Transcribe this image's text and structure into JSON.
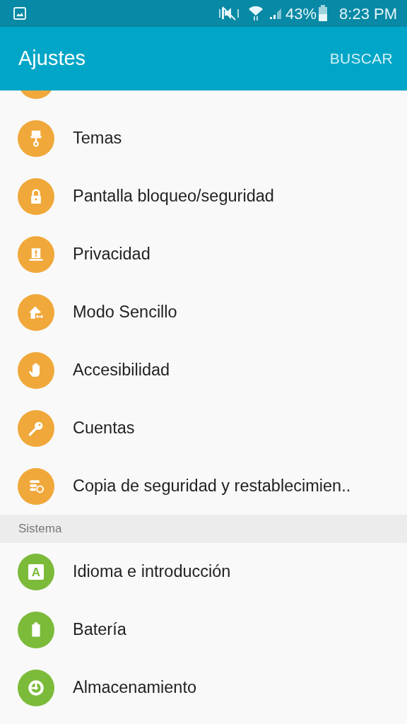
{
  "status_bar": {
    "battery_text": "43%",
    "time": "8:23 PM"
  },
  "app_bar": {
    "title": "Ajustes",
    "action": "BUSCAR"
  },
  "sections": [
    {
      "items": [
        {
          "kind": "partial",
          "color": "#f0a83a"
        },
        {
          "kind": "brush",
          "label": "Temas",
          "color": "#f0a83a"
        },
        {
          "kind": "lock",
          "label": "Pantalla bloqueo/seguridad",
          "color": "#f0a83a"
        },
        {
          "kind": "privacy",
          "label": "Privacidad",
          "color": "#f0a83a"
        },
        {
          "kind": "home",
          "label": "Modo Sencillo",
          "color": "#f0a83a"
        },
        {
          "kind": "hand",
          "label": "Accesibilidad",
          "color": "#f0a83a"
        },
        {
          "kind": "key",
          "label": "Cuentas",
          "color": "#f0a83a"
        },
        {
          "kind": "backup",
          "label": "Copia de seguridad y restablecimien..",
          "color": "#f0a83a"
        }
      ]
    },
    {
      "header": "Sistema",
      "items": [
        {
          "kind": "language",
          "icon_label": "A",
          "label": "Idioma e introducción",
          "color": "#7cbb3a"
        },
        {
          "kind": "battery",
          "label": "Batería",
          "color": "#7cbb3a"
        },
        {
          "kind": "storage",
          "label": "Almacenamiento",
          "color": "#7cbb3a"
        }
      ]
    }
  ]
}
